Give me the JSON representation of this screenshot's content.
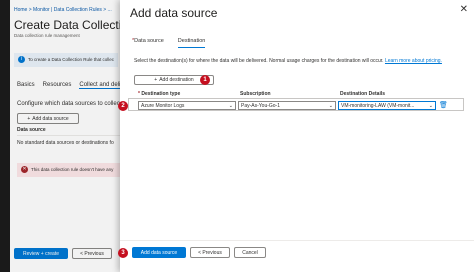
{
  "background": {
    "breadcrumb": "Home > Monitor | Data Collection Rules > ...",
    "title": "Create Data Collection Ru",
    "subtitle": "Data collection rule management",
    "info_text": "To create a Data Collection Rule that collec",
    "tabs": [
      {
        "label": "Basics"
      },
      {
        "label": "Resources"
      },
      {
        "label": "Collect and deliv",
        "active": true
      }
    ],
    "config_text": "Configure which data sources to collect",
    "add_data_source_label": "Add data source",
    "data_source_header": "Data source",
    "no_standard_text": "No standard data sources or destinations fo",
    "error_text": "This data collection rule doesn't have any",
    "review_create_label": "Review + create",
    "previous_label": "< Previous"
  },
  "panel": {
    "title": "Add data source",
    "tabs": [
      {
        "label": "Data source",
        "required": true
      },
      {
        "label": "Destination",
        "active": true
      }
    ],
    "description": "Select the destination(s) for where the data will be delivered. Normal usage charges for the destination will occur.",
    "learn_more": "Learn more about pricing.",
    "add_destination_label": "Add destination",
    "columns": {
      "type": "Destination type",
      "subscription": "Subscription",
      "details": "Destination Details"
    },
    "row": {
      "type": "Azure Monitor Logs",
      "subscription": "Pay-As-You-Go-1",
      "details": "VM-monitoring-LAW (VM-monit..."
    },
    "footer": {
      "add_data_source": "Add data source",
      "previous": "< Previous",
      "cancel": "Cancel"
    }
  },
  "markers": {
    "m1": "1",
    "m2": "2",
    "m3": "3"
  }
}
